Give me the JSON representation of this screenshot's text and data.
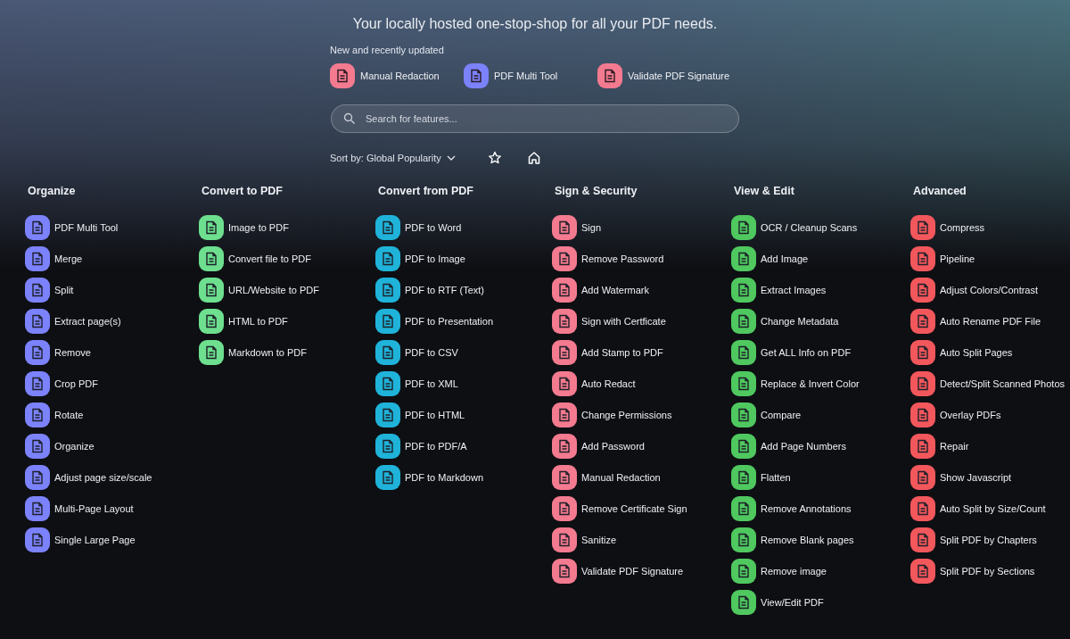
{
  "tagline": "Your locally hosted one-stop-shop for all your PDF needs.",
  "recent": {
    "title": "New and recently updated",
    "items": [
      {
        "label": "Manual Redaction",
        "color": "#f47a8f"
      },
      {
        "label": "PDF Multi Tool",
        "color": "#7b82fb"
      },
      {
        "label": "Validate PDF Signature",
        "color": "#f47a8f"
      }
    ]
  },
  "search": {
    "placeholder": "Search for features..."
  },
  "sort": {
    "label": "Sort by: Global Popularity"
  },
  "groups": [
    {
      "title": "Organize",
      "color": "#7b82fb",
      "items": [
        "PDF Multi Tool",
        "Merge",
        "Split",
        "Extract page(s)",
        "Remove",
        "Crop PDF",
        "Rotate",
        "Organize",
        "Adjust page size/scale",
        "Multi-Page Layout",
        "Single Large Page"
      ]
    },
    {
      "title": "Convert to PDF",
      "color": "#6ddf8e",
      "items": [
        "Image to PDF",
        "Convert file to PDF",
        "URL/Website to PDF",
        "HTML to PDF",
        "Markdown to PDF"
      ]
    },
    {
      "title": "Convert from PDF",
      "color": "#1fb3da",
      "items": [
        "PDF to Word",
        "PDF to Image",
        "PDF to RTF (Text)",
        "PDF to Presentation",
        "PDF to CSV",
        "PDF to XML",
        "PDF to HTML",
        "PDF to PDF/A",
        "PDF to Markdown"
      ]
    },
    {
      "title": "Sign & Security",
      "color": "#f47a8f",
      "items": [
        "Sign",
        "Remove Password",
        "Add Watermark",
        "Sign with Certficate",
        "Add Stamp to PDF",
        "Auto Redact",
        "Change Permissions",
        "Add Password",
        "Manual Redaction",
        "Remove Certificate Sign",
        "Sanitize",
        "Validate PDF Signature"
      ]
    },
    {
      "title": "View & Edit",
      "color": "#4fc85f",
      "items": [
        "OCR / Cleanup Scans",
        "Add Image",
        "Extract Images",
        "Change Metadata",
        "Get ALL Info on PDF",
        "Replace & Invert Color",
        "Compare",
        "Add Page Numbers",
        "Flatten",
        "Remove Annotations",
        "Remove Blank pages",
        "Remove image",
        "View/Edit PDF"
      ]
    },
    {
      "title": "Advanced",
      "color": "#f2575c",
      "items": [
        "Compress",
        "Pipeline",
        "Adjust Colors/Contrast",
        "Auto Rename PDF File",
        "Auto Split Pages",
        "Detect/Split Scanned Photos",
        "Overlay PDFs",
        "Repair",
        "Show Javascript",
        "Auto Split by Size/Count",
        "Split PDF by Chapters",
        "Split PDF by Sections"
      ]
    }
  ]
}
